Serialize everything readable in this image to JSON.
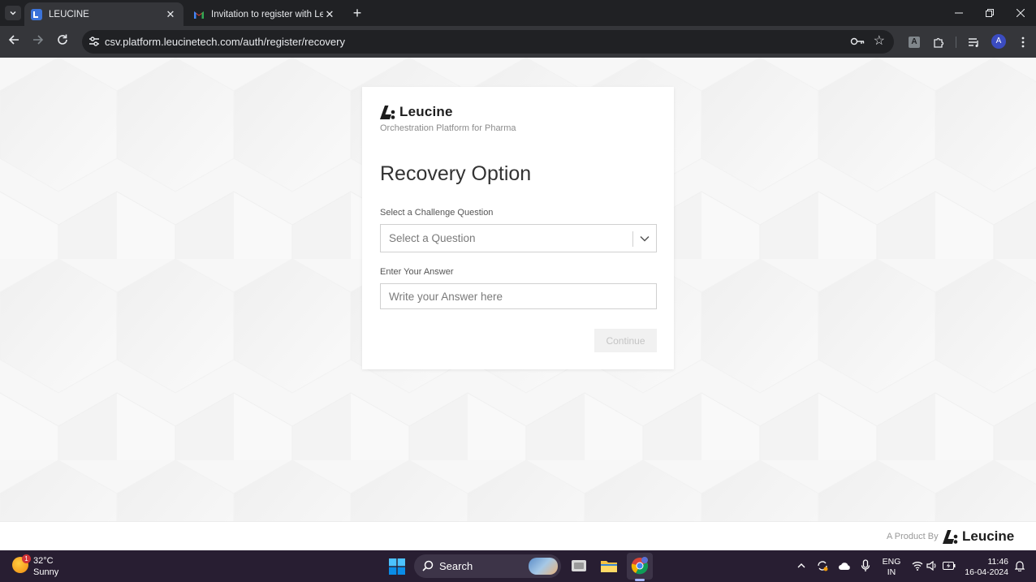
{
  "browser": {
    "tabs": [
      {
        "title": "LEUCINE",
        "active": true
      },
      {
        "title": "Invitation to register with Leucine",
        "active": false
      }
    ],
    "url": "csv.platform.leucinetech.com/auth/register/recovery",
    "avatar_initial": "A",
    "extension_initial": "A"
  },
  "page": {
    "brand": {
      "name": "Leucine",
      "tagline": "Orchestration Platform for Pharma"
    },
    "title": "Recovery Option",
    "question_field": {
      "label": "Select a Challenge Question",
      "placeholder": "Select a Question"
    },
    "answer_field": {
      "label": "Enter Your Answer",
      "placeholder": "Write your Answer here",
      "value": ""
    },
    "continue_label": "Continue",
    "footer": {
      "label": "A Product By",
      "brand": "Leucine"
    }
  },
  "taskbar": {
    "weather": {
      "temp": "32°C",
      "desc": "Sunny",
      "badge": "1"
    },
    "search_label": "Search",
    "language": {
      "line1": "ENG",
      "line2": "IN"
    },
    "time": "11:46",
    "date": "16-04-2024"
  },
  "colors": {
    "browser_frame": "#202124",
    "toolbar": "#35363a",
    "page_bg": "#f6f6f6",
    "taskbar": "#281e32",
    "button_disabled_bg": "#f1f1f1"
  }
}
